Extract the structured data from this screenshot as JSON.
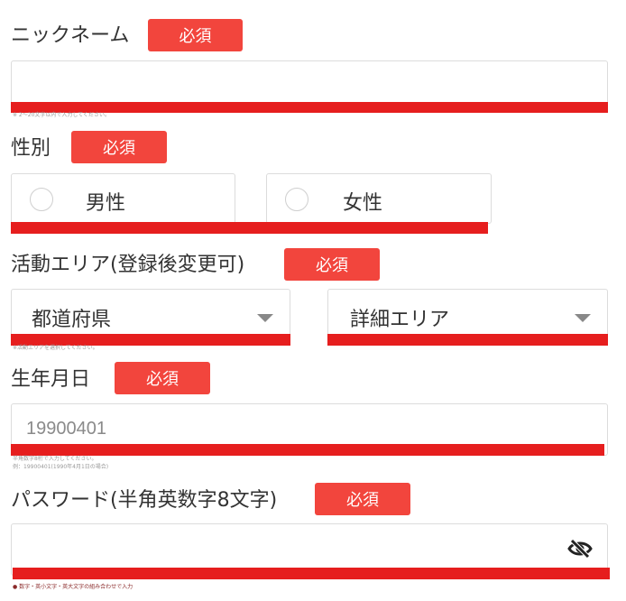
{
  "nickname": {
    "label": "ニックネーム",
    "required": "必須",
    "hint": "※ 2〜20文字以内で入力してください。"
  },
  "gender": {
    "label": "性別",
    "required": "必須",
    "options": [
      "男性",
      "女性"
    ]
  },
  "area": {
    "label": "活動エリア(登録後変更可)",
    "required": "必須",
    "prefecture": "都道府県",
    "detail": "詳細エリア",
    "hint": "※活動エリアを選択してください。"
  },
  "birthday": {
    "label": "生年月日",
    "required": "必須",
    "value": "19900401",
    "hint1": "半角数字8桁で入力してください。",
    "hint2": "例：19900401(1990年4月1日の場合)"
  },
  "password": {
    "label": "パスワード(半角英数字8文字)",
    "required": "必須",
    "hint": "● 数字・英小文字・英大文字の組み合わせで入力"
  },
  "icons": {
    "caret": "chevron-down-icon",
    "eye": "eye-off-icon",
    "warning": "info-dot-icon"
  },
  "colors": {
    "required_bg": "#f2453d",
    "redline": "#e61e1e",
    "border": "#dcdcdc",
    "text": "#333333"
  }
}
